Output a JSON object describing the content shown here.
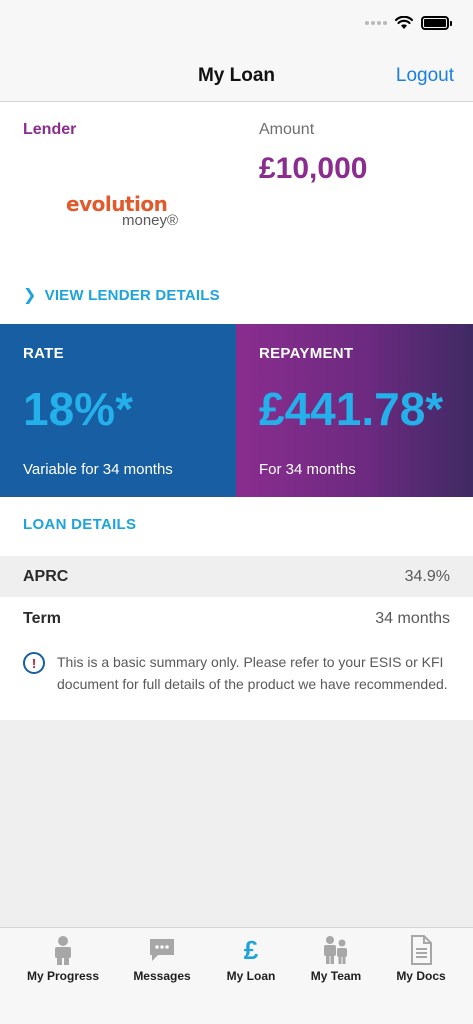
{
  "nav": {
    "title": "My Loan",
    "logout_label": "Logout"
  },
  "lender": {
    "label": "Lender",
    "logo_text_top": "evolution",
    "logo_text_bottom": "money®",
    "view_details_label": "VIEW LENDER DETAILS"
  },
  "amount": {
    "label": "Amount",
    "value": "£10,000"
  },
  "rate": {
    "title": "RATE",
    "value": "18%*",
    "subtitle": "Variable for 34 months"
  },
  "repayment": {
    "title": "REPAYMENT",
    "value": "£441.78*",
    "subtitle": "For 34 months"
  },
  "loan_details": {
    "title": "LOAN DETAILS",
    "rows": [
      {
        "label": "APRC",
        "value": "34.9%"
      },
      {
        "label": "Term",
        "value": "34 months"
      }
    ],
    "notice": "This is a basic summary only. Please refer to your ESIS or KFI document for full details of the product we have recommended."
  },
  "tabs": [
    {
      "label": "My Progress",
      "icon": "person-icon"
    },
    {
      "label": "Messages",
      "icon": "message-icon"
    },
    {
      "label": "My Loan",
      "icon": "pound-icon",
      "active": true
    },
    {
      "label": "My Team",
      "icon": "team-icon"
    },
    {
      "label": "My Docs",
      "icon": "document-icon"
    }
  ],
  "colors": {
    "brand_purple": "#8a2d8f",
    "brand_blue": "#175ea2",
    "accent_cyan": "#1da4dc",
    "link_blue": "#1a7fe3",
    "logo_orange": "#e25a2b"
  }
}
